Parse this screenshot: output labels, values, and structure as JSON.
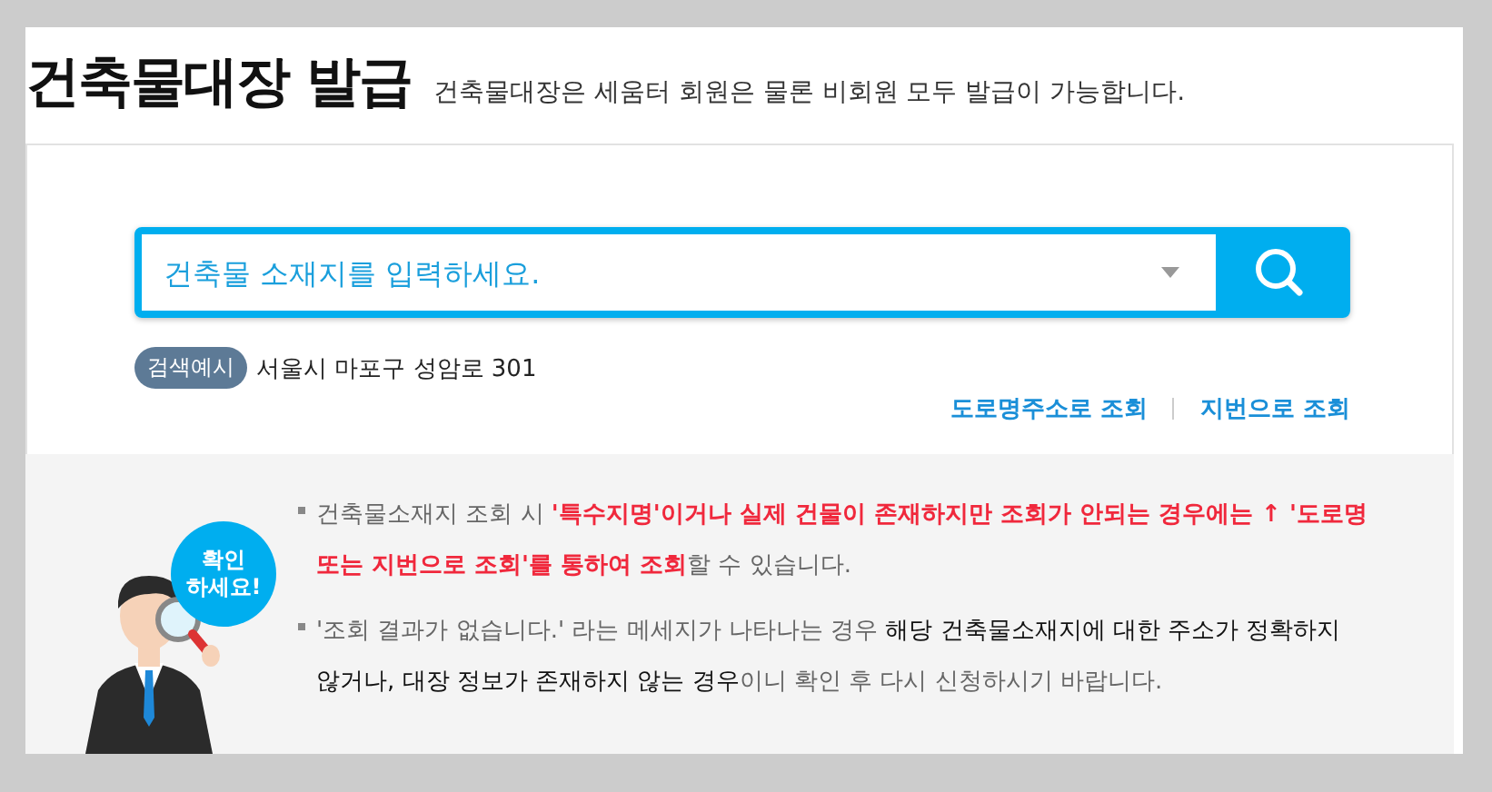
{
  "header": {
    "title": "건축물대장 발급",
    "subtitle": "건축물대장은 세움터 회원은 물론 비회원 모두 발급이 가능합니다."
  },
  "search": {
    "placeholder": "건축물 소재지를 입력하세요.",
    "example_badge": "검색예시",
    "example_text": "서울시 마포구 성암로 301",
    "links": [
      "도로명주소로 조회",
      "지번으로 조회"
    ]
  },
  "notice": {
    "badge": "확인\n하세요!",
    "items": [
      {
        "kind": "warning",
        "text": "건축물소재지 조회 시 **'특수지명'이거나 실제 건물이 존재하지만 조회가 안되는 경우에는 ↑ '도로명 또는 지번으로 조회'를 통하여 조회**할 수 있습니다."
      },
      {
        "kind": "info",
        "text": "'조회 결과가 없습니다.' 라는 메세지가 나타나는 경우 **해당 건축물소재지에 대한 주소가 정확하지 않거나, 대장 정보가 존재하지 않는 경우**이니 확인 후 다시 신청하시기 바랍니다."
      }
    ]
  }
}
